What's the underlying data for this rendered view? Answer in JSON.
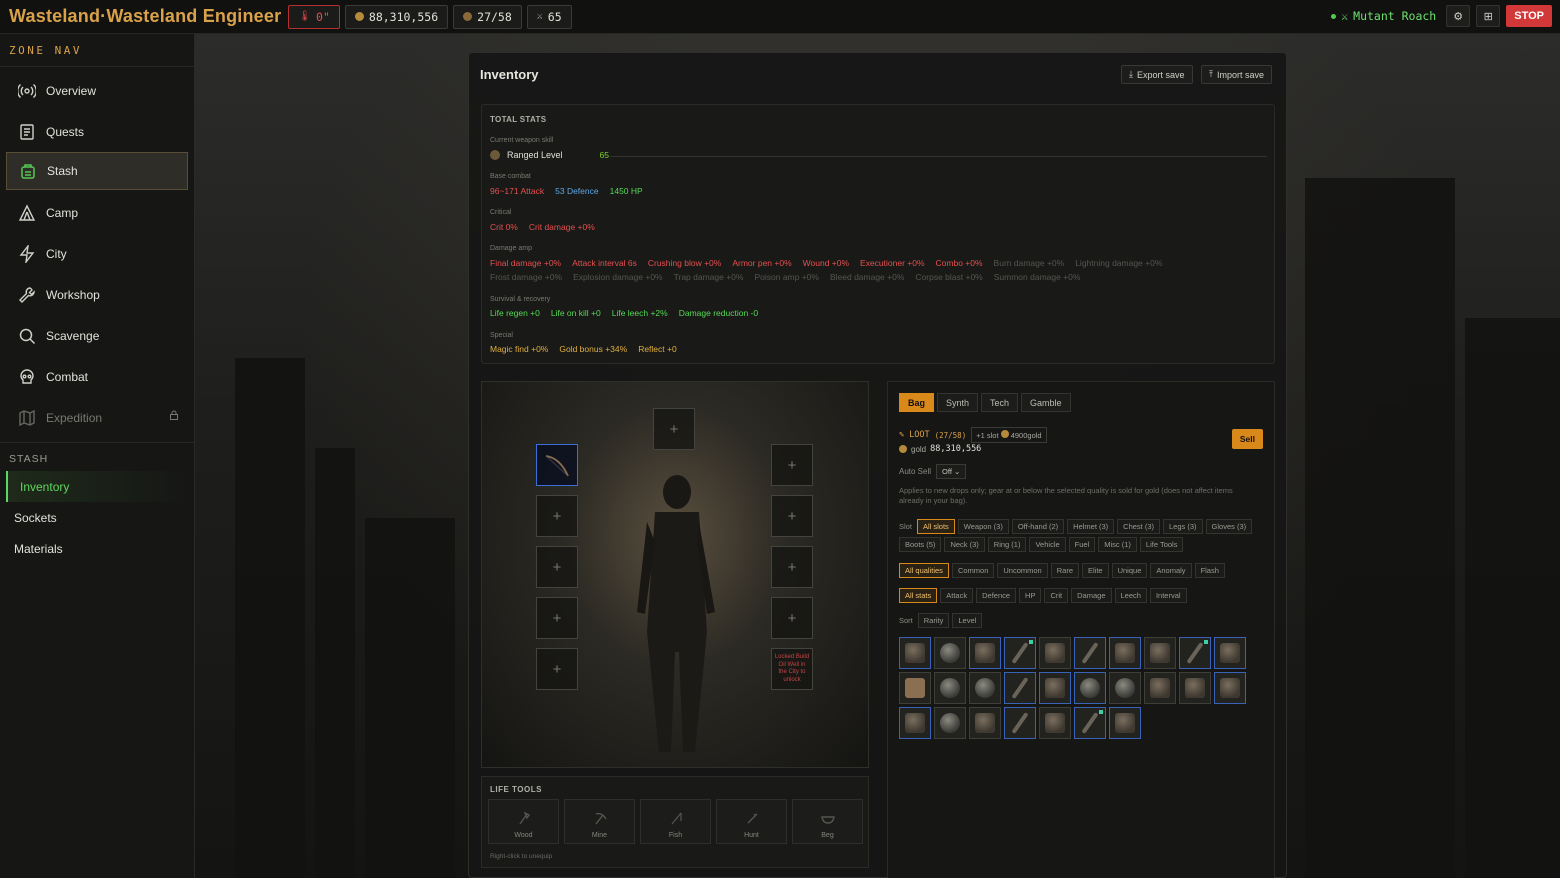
{
  "app": {
    "title": "Wasteland·Wasteland Engineer",
    "alert_chip": "0\"",
    "gold_chip": "88,310,556",
    "bag_chip": "27/58",
    "level_chip": "65"
  },
  "enemy": {
    "name": "Mutant Roach",
    "status_color": "#4cd04c"
  },
  "topbar": {
    "stop_label": "STOP",
    "settings_icon": "gear-icon",
    "layout_icon": "layout-icon"
  },
  "sidebar": {
    "heading": "ZONE NAV",
    "items": [
      {
        "label": "Overview",
        "icon": "radio-icon"
      },
      {
        "label": "Quests",
        "icon": "scroll-icon"
      },
      {
        "label": "Stash",
        "icon": "backpack-icon"
      },
      {
        "label": "Camp",
        "icon": "tent-icon"
      },
      {
        "label": "City",
        "icon": "lightning-icon"
      },
      {
        "label": "Workshop",
        "icon": "wrench-icon"
      },
      {
        "label": "Scavenge",
        "icon": "search-icon"
      },
      {
        "label": "Combat",
        "icon": "skull-icon"
      },
      {
        "label": "Expedition",
        "icon": "map-icon"
      }
    ],
    "stash_heading": "STASH",
    "stash_items": [
      {
        "label": "Inventory"
      },
      {
        "label": "Sockets"
      },
      {
        "label": "Materials"
      }
    ]
  },
  "panel": {
    "title": "Inventory",
    "export_label": "Export save",
    "import_label": "Import save"
  },
  "stats": {
    "title": "TOTAL STATS",
    "skill_label": "Current weapon skill",
    "skill_name": "Ranged Level",
    "skill_value": "65",
    "base_label": "Base combat",
    "base": {
      "attack": "96~171 Attack",
      "defence": "53 Defence",
      "hp": "1450 HP"
    },
    "crit_label": "Critical",
    "crit": {
      "crit": "Crit 0%",
      "crit_damage": "Crit damage +0%"
    },
    "dmg_label": "Damage amp",
    "dmg_row1": {
      "final": "Final damage +0%",
      "interval": "Attack interval 6s",
      "crushing": "Crushing blow +0%",
      "armor": "Armor pen +0%",
      "wound": "Wound +0%",
      "executioner": "Executioner +0%",
      "combo": "Combo +0%",
      "burn": "Burn damage +0%",
      "lightning": "Lightning damage +0%"
    },
    "dmg_row2": {
      "frost": "Frost damage +0%",
      "explosion": "Explosion damage +0%",
      "trap": "Trap damage +0%",
      "poison": "Poison amp +0%",
      "bleed": "Bleed damage +0%",
      "corpse": "Corpse blast +0%",
      "summon": "Summon damage +0%"
    },
    "survival_label": "Survival & recovery",
    "survival": {
      "regen": "Life regen +0",
      "onkill": "Life on kill +0",
      "leech": "Life leech +2%",
      "reduction": "Damage reduction -0"
    },
    "special_label": "Special",
    "special": {
      "magic": "Magic find +0%",
      "gold": "Gold bonus +34%",
      "reflect": "Reflect +0"
    }
  },
  "paperdoll": {
    "empty_glyph": "+",
    "locked_text": "Locked Build Oil Well in the City to unlock"
  },
  "life_tools": {
    "title": "LIFE TOOLS",
    "tools": [
      {
        "label": "Wood"
      },
      {
        "label": "Mine"
      },
      {
        "label": "Fish"
      },
      {
        "label": "Hunt"
      },
      {
        "label": "Beg"
      }
    ],
    "hint": "Right-click to unequip"
  },
  "bag": {
    "tabs": [
      {
        "label": "Bag"
      },
      {
        "label": "Synth"
      },
      {
        "label": "Tech"
      },
      {
        "label": "Gamble"
      }
    ],
    "loot_label": "LOOT",
    "loot_count": "(27/58)",
    "slot_chip": "+1 slot",
    "slot_price": "4900gold",
    "gold_label": "gold",
    "gold_value": "88,310,556",
    "sell_label": "Sell",
    "autosell_label": "Auto Sell",
    "autosell_value": "Off",
    "note": "Applies to new drops only; gear at or below the selected quality is sold for gold (does not affect items already in your bag).",
    "slot_label": "Slot",
    "slots": [
      "All slots",
      "Weapon (3)",
      "Off-hand (2)",
      "Helmet (3)",
      "Chest (3)",
      "Legs (3)",
      "Gloves (3)",
      "Boots (5)",
      "Neck (3)",
      "Ring (1)",
      "Vehicle",
      "Fuel",
      "Misc (1)",
      "Life Tools"
    ],
    "qualities": [
      "All qualities",
      "Common",
      "Uncommon",
      "Rare",
      "Elite",
      "Unique",
      "Anomaly",
      "Flash"
    ],
    "statfilters": [
      "All stats",
      "Attack",
      "Defence",
      "HP",
      "Crit",
      "Damage",
      "Leech",
      "Interval"
    ],
    "sort_label": "Sort",
    "sorts": [
      "Rarity",
      "Level"
    ]
  },
  "colors": {
    "accent": "#d9881a",
    "brand": "#d9a24a",
    "active_green": "#57c957",
    "equipped_blue": "#3b6ed8"
  }
}
